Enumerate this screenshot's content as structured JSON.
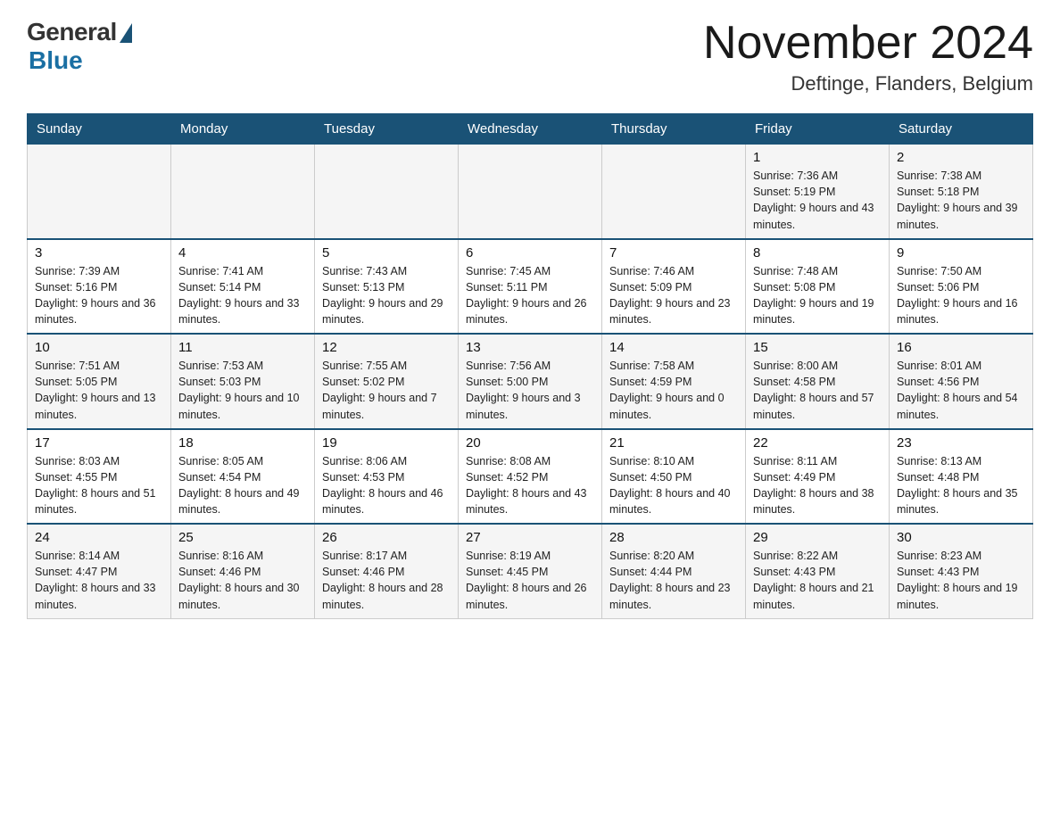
{
  "header": {
    "logo": {
      "general": "General",
      "blue": "Blue"
    },
    "title": "November 2024",
    "location": "Deftinge, Flanders, Belgium"
  },
  "weekdays": [
    "Sunday",
    "Monday",
    "Tuesday",
    "Wednesday",
    "Thursday",
    "Friday",
    "Saturday"
  ],
  "weeks": [
    [
      {
        "day": "",
        "info": ""
      },
      {
        "day": "",
        "info": ""
      },
      {
        "day": "",
        "info": ""
      },
      {
        "day": "",
        "info": ""
      },
      {
        "day": "",
        "info": ""
      },
      {
        "day": "1",
        "info": "Sunrise: 7:36 AM\nSunset: 5:19 PM\nDaylight: 9 hours and 43 minutes."
      },
      {
        "day": "2",
        "info": "Sunrise: 7:38 AM\nSunset: 5:18 PM\nDaylight: 9 hours and 39 minutes."
      }
    ],
    [
      {
        "day": "3",
        "info": "Sunrise: 7:39 AM\nSunset: 5:16 PM\nDaylight: 9 hours and 36 minutes."
      },
      {
        "day": "4",
        "info": "Sunrise: 7:41 AM\nSunset: 5:14 PM\nDaylight: 9 hours and 33 minutes."
      },
      {
        "day": "5",
        "info": "Sunrise: 7:43 AM\nSunset: 5:13 PM\nDaylight: 9 hours and 29 minutes."
      },
      {
        "day": "6",
        "info": "Sunrise: 7:45 AM\nSunset: 5:11 PM\nDaylight: 9 hours and 26 minutes."
      },
      {
        "day": "7",
        "info": "Sunrise: 7:46 AM\nSunset: 5:09 PM\nDaylight: 9 hours and 23 minutes."
      },
      {
        "day": "8",
        "info": "Sunrise: 7:48 AM\nSunset: 5:08 PM\nDaylight: 9 hours and 19 minutes."
      },
      {
        "day": "9",
        "info": "Sunrise: 7:50 AM\nSunset: 5:06 PM\nDaylight: 9 hours and 16 minutes."
      }
    ],
    [
      {
        "day": "10",
        "info": "Sunrise: 7:51 AM\nSunset: 5:05 PM\nDaylight: 9 hours and 13 minutes."
      },
      {
        "day": "11",
        "info": "Sunrise: 7:53 AM\nSunset: 5:03 PM\nDaylight: 9 hours and 10 minutes."
      },
      {
        "day": "12",
        "info": "Sunrise: 7:55 AM\nSunset: 5:02 PM\nDaylight: 9 hours and 7 minutes."
      },
      {
        "day": "13",
        "info": "Sunrise: 7:56 AM\nSunset: 5:00 PM\nDaylight: 9 hours and 3 minutes."
      },
      {
        "day": "14",
        "info": "Sunrise: 7:58 AM\nSunset: 4:59 PM\nDaylight: 9 hours and 0 minutes."
      },
      {
        "day": "15",
        "info": "Sunrise: 8:00 AM\nSunset: 4:58 PM\nDaylight: 8 hours and 57 minutes."
      },
      {
        "day": "16",
        "info": "Sunrise: 8:01 AM\nSunset: 4:56 PM\nDaylight: 8 hours and 54 minutes."
      }
    ],
    [
      {
        "day": "17",
        "info": "Sunrise: 8:03 AM\nSunset: 4:55 PM\nDaylight: 8 hours and 51 minutes."
      },
      {
        "day": "18",
        "info": "Sunrise: 8:05 AM\nSunset: 4:54 PM\nDaylight: 8 hours and 49 minutes."
      },
      {
        "day": "19",
        "info": "Sunrise: 8:06 AM\nSunset: 4:53 PM\nDaylight: 8 hours and 46 minutes."
      },
      {
        "day": "20",
        "info": "Sunrise: 8:08 AM\nSunset: 4:52 PM\nDaylight: 8 hours and 43 minutes."
      },
      {
        "day": "21",
        "info": "Sunrise: 8:10 AM\nSunset: 4:50 PM\nDaylight: 8 hours and 40 minutes."
      },
      {
        "day": "22",
        "info": "Sunrise: 8:11 AM\nSunset: 4:49 PM\nDaylight: 8 hours and 38 minutes."
      },
      {
        "day": "23",
        "info": "Sunrise: 8:13 AM\nSunset: 4:48 PM\nDaylight: 8 hours and 35 minutes."
      }
    ],
    [
      {
        "day": "24",
        "info": "Sunrise: 8:14 AM\nSunset: 4:47 PM\nDaylight: 8 hours and 33 minutes."
      },
      {
        "day": "25",
        "info": "Sunrise: 8:16 AM\nSunset: 4:46 PM\nDaylight: 8 hours and 30 minutes."
      },
      {
        "day": "26",
        "info": "Sunrise: 8:17 AM\nSunset: 4:46 PM\nDaylight: 8 hours and 28 minutes."
      },
      {
        "day": "27",
        "info": "Sunrise: 8:19 AM\nSunset: 4:45 PM\nDaylight: 8 hours and 26 minutes."
      },
      {
        "day": "28",
        "info": "Sunrise: 8:20 AM\nSunset: 4:44 PM\nDaylight: 8 hours and 23 minutes."
      },
      {
        "day": "29",
        "info": "Sunrise: 8:22 AM\nSunset: 4:43 PM\nDaylight: 8 hours and 21 minutes."
      },
      {
        "day": "30",
        "info": "Sunrise: 8:23 AM\nSunset: 4:43 PM\nDaylight: 8 hours and 19 minutes."
      }
    ]
  ]
}
